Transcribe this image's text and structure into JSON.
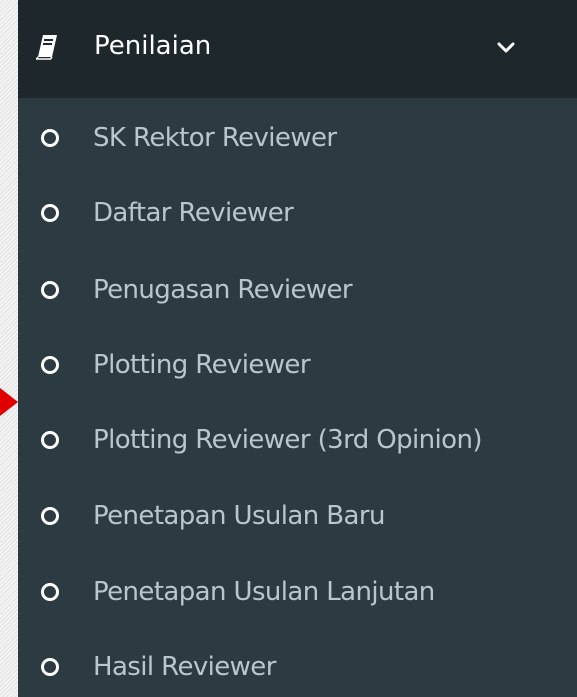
{
  "pointer": {
    "icon": "red-triangle-arrow-icon",
    "color": "#e00000"
  },
  "menu": {
    "title": "Penilaian",
    "title_icon": "book-icon",
    "toggle_icon": "chevron-down-icon",
    "colors": {
      "header_bg": "#1e282c",
      "list_bg": "#2c3b41",
      "header_text": "#ffffff",
      "item_text": "#b8c7ce"
    },
    "items": [
      {
        "label": "SK Rektor Reviewer",
        "icon": "circle-outline-icon"
      },
      {
        "label": "Daftar Reviewer",
        "icon": "circle-outline-icon"
      },
      {
        "label": "Penugasan Reviewer",
        "icon": "circle-outline-icon"
      },
      {
        "label": "Plotting Reviewer",
        "icon": "circle-outline-icon"
      },
      {
        "label": "Plotting Reviewer (3rd Opinion)",
        "icon": "circle-outline-icon"
      },
      {
        "label": "Penetapan Usulan Baru",
        "icon": "circle-outline-icon"
      },
      {
        "label": "Penetapan Usulan Lanjutan",
        "icon": "circle-outline-icon"
      },
      {
        "label": "Hasil Reviewer",
        "icon": "circle-outline-icon"
      }
    ]
  }
}
